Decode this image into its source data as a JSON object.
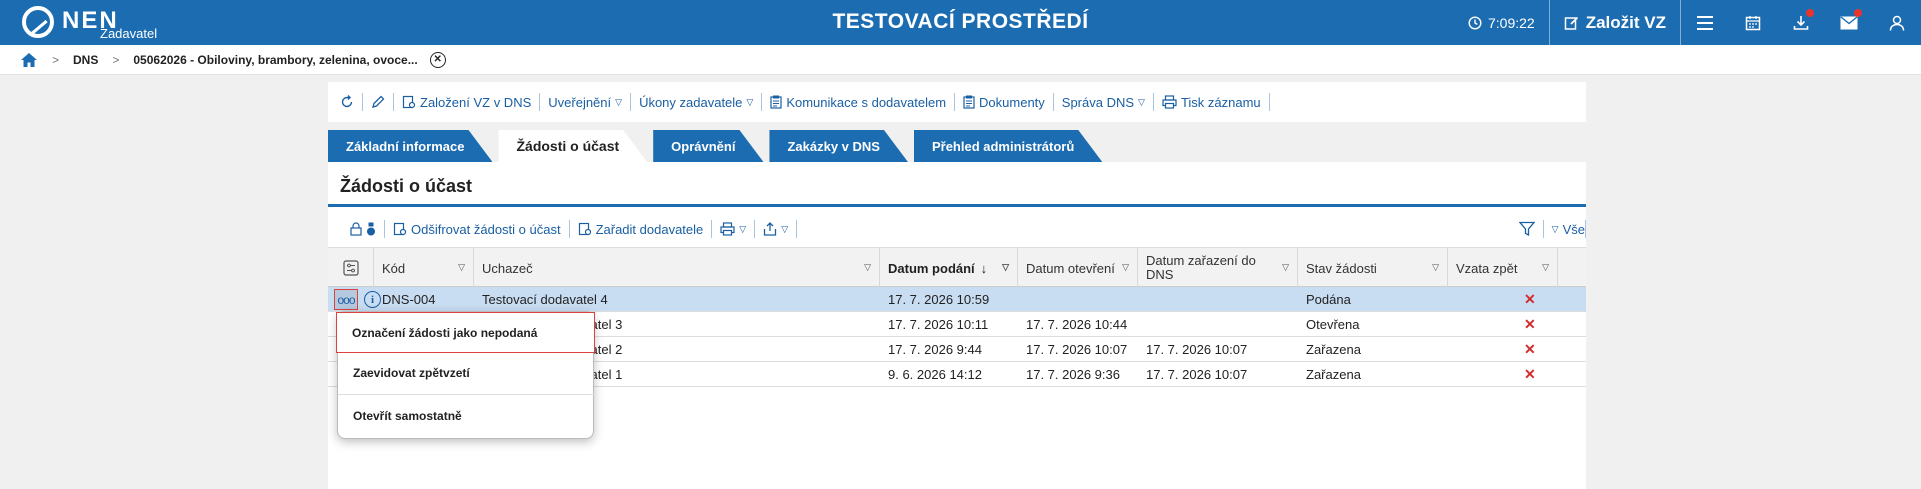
{
  "topbar": {
    "logo_text": "NEN",
    "logo_sub": "Zadavatel",
    "environment": "TESTOVACÍ PROSTŘEDÍ",
    "time": "7:09:22",
    "create_label": "Založit VZ",
    "brand_color": "#1c6cb1"
  },
  "breadcrumb": {
    "items": [
      "DNS",
      "05062026 - Obiloviny, brambory, zelenina, ovoce..."
    ]
  },
  "action_bar": {
    "items": [
      "Založení VZ v DNS",
      "Uveřejnění",
      "Úkony zadavatele",
      "Komunikace s dodavatelem",
      "Dokumenty",
      "Správa DNS",
      "Tisk záznamu"
    ]
  },
  "tabs": [
    {
      "label": "Základní informace"
    },
    {
      "label": "Žádosti o účast"
    },
    {
      "label": "Oprávnění"
    },
    {
      "label": "Zakázky v DNS"
    },
    {
      "label": "Přehled administrátorů"
    }
  ],
  "section": {
    "title": "Žádosti o účast"
  },
  "grid_toolbar": {
    "decrypt": "Odšifrovat žádosti o účast",
    "assign": "Zařadit dodavatele",
    "all_label": "Vše"
  },
  "table": {
    "columns": [
      "Kód",
      "Uchazeč",
      "Datum podání",
      "Datum otevření",
      "Datum zařazení do DNS",
      "Stav žádosti",
      "Vzata zpět"
    ],
    "rows": [
      {
        "kod": "DNS-004",
        "uchazec": "Testovací dodavatel 4",
        "podani": "17. 7. 2026 10:59",
        "otevreni": "",
        "zarazeni": "",
        "stav": "Podána",
        "vzata": "✕"
      },
      {
        "kod": "",
        "uchazec": "vatel 3",
        "podani": "17. 7. 2026 10:11",
        "otevreni": "17. 7. 2026 10:44",
        "zarazeni": "",
        "stav": "Otevřena",
        "vzata": "✕"
      },
      {
        "kod": "",
        "uchazec": "vatel 2",
        "podani": "17. 7. 2026 9:44",
        "otevreni": "17. 7. 2026 10:07",
        "zarazeni": "17. 7. 2026 10:07",
        "stav": "Zařazena",
        "vzata": "✕"
      },
      {
        "kod": "",
        "uchazec": "vatel 1",
        "podani": "9. 6. 2026 14:12",
        "otevreni": "17. 7. 2026 9:36",
        "zarazeni": "17. 7. 2026 10:07",
        "stav": "Zařazena",
        "vzata": "✕"
      }
    ]
  },
  "context_menu": {
    "items": [
      "Označení žádosti jako nepodaná",
      "Zaevidovat zpětvzetí",
      "Otevřít samostatně"
    ]
  }
}
